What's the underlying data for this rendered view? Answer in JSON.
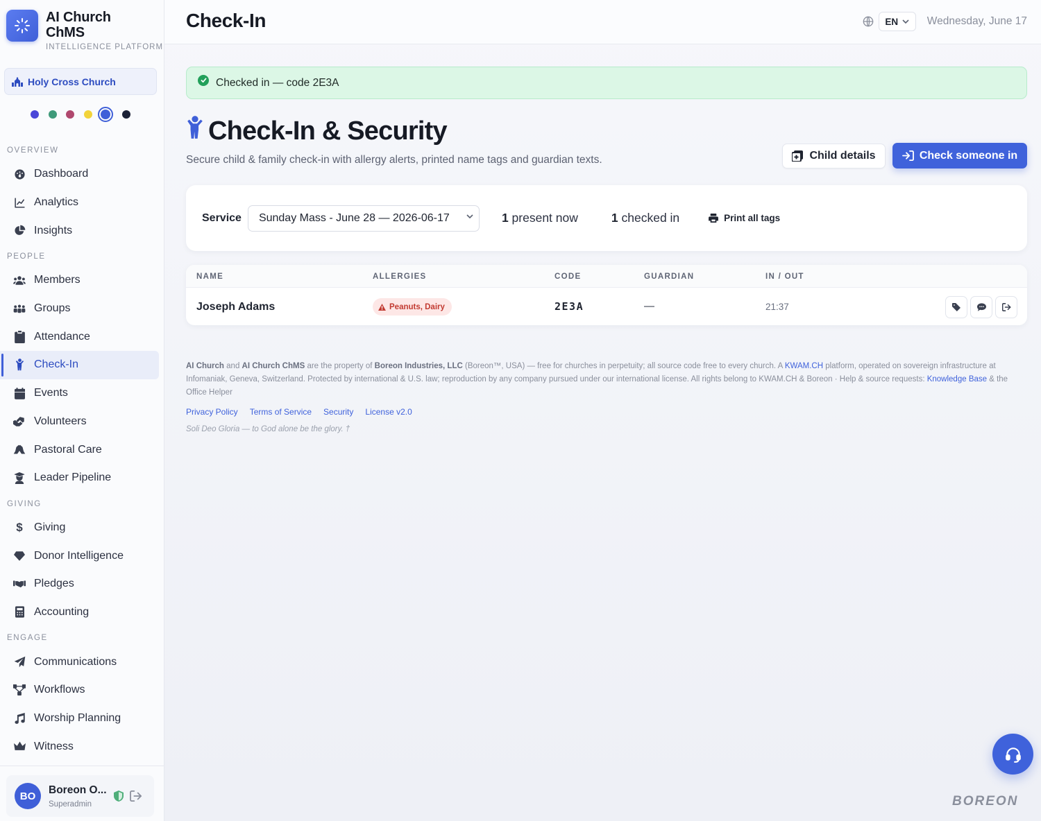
{
  "brand": {
    "title_line1": "AI Church",
    "title_line2": "ChMS",
    "subtitle": "INTELLIGENCE PLATFORM"
  },
  "church": {
    "name": "Holy Cross Church"
  },
  "theme_swatches": [
    "#4a47d8",
    "#3f9a7a",
    "#b0486e",
    "#f2d33a",
    "#3f5fd8",
    "#1b2136"
  ],
  "nav": {
    "sections": [
      {
        "label": "OVERVIEW",
        "items": [
          {
            "label": "Dashboard",
            "icon": "gauge-icon"
          },
          {
            "label": "Analytics",
            "icon": "line-chart-icon"
          },
          {
            "label": "Insights",
            "icon": "pie-chart-icon"
          }
        ]
      },
      {
        "label": "PEOPLE",
        "items": [
          {
            "label": "Members",
            "icon": "users-icon"
          },
          {
            "label": "Groups",
            "icon": "people-group-icon"
          },
          {
            "label": "Attendance",
            "icon": "clipboard-check-icon"
          },
          {
            "label": "Check-In",
            "icon": "child-icon",
            "active": true
          },
          {
            "label": "Events",
            "icon": "calendar-icon"
          },
          {
            "label": "Volunteers",
            "icon": "hands-helping-icon"
          },
          {
            "label": "Pastoral Care",
            "icon": "praying-hands-icon"
          },
          {
            "label": "Leader Pipeline",
            "icon": "graduate-icon"
          }
        ]
      },
      {
        "label": "GIVING",
        "items": [
          {
            "label": "Giving",
            "icon": "dollar-icon"
          },
          {
            "label": "Donor Intelligence",
            "icon": "gem-icon"
          },
          {
            "label": "Pledges",
            "icon": "handshake-icon"
          },
          {
            "label": "Accounting",
            "icon": "calculator-icon"
          }
        ]
      },
      {
        "label": "ENGAGE",
        "items": [
          {
            "label": "Communications",
            "icon": "paper-plane-icon"
          },
          {
            "label": "Workflows",
            "icon": "workflow-icon"
          },
          {
            "label": "Worship Planning",
            "icon": "music-icon"
          },
          {
            "label": "Witness",
            "icon": "crown-icon"
          }
        ]
      }
    ]
  },
  "user": {
    "initials": "BO",
    "name": "Boreon O...",
    "role": "Superadmin"
  },
  "topbar": {
    "title": "Check-In",
    "language": "EN",
    "date": "Wednesday, June 17"
  },
  "alert": {
    "text": "Checked in — code 2E3A"
  },
  "hero": {
    "title": "Check-In & Security",
    "subtitle": "Secure child & family check-in with allergy alerts, printed name tags and guardian texts."
  },
  "actions": {
    "child_details": "Child details",
    "check_in": "Check someone in"
  },
  "filter": {
    "label": "Service",
    "selected_service": "Sunday Mass - June 28 — 2026-06-17",
    "present_count": "1",
    "present_label": "present now",
    "checked_count": "1",
    "checked_label": "checked in",
    "print_label": "Print all tags"
  },
  "table": {
    "columns": [
      "NAME",
      "ALLERGIES",
      "CODE",
      "GUARDIAN",
      "IN / OUT"
    ],
    "rows": [
      {
        "name": "Joseph Adams",
        "allergies": "Peanuts, Dairy",
        "code": "2E3A",
        "guardian": "—",
        "in_out": "21:37"
      }
    ]
  },
  "footer": {
    "p1_brand1": "AI Church",
    "p1_and": " and ",
    "p1_brand2": "AI Church ChMS",
    "p1_prop": " are the property of ",
    "p1_company": "Boreon Industries, LLC",
    "p1_rest": " (Boreon™, USA) — free for churches in perpetuity; all source code free to every church. A ",
    "p1_kwam": "KWAM.CH",
    "p1_rest2": " platform, operated on sovereign infrastructure at Infomaniak, Geneva, Switzerland. Protected by international & U.S. law; reproduction by any company pursued under our international license. All rights belong to KWAM.CH & Boreon · Help & source requests: ",
    "p1_kb": "Knowledge Base",
    "p1_end": " & the Office Helper",
    "links": [
      "Privacy Policy",
      "Terms of Service",
      "Security",
      "License v2.0"
    ],
    "motto": "Soli Deo Gloria — to God alone be the glory. †"
  },
  "watermark": "BOREON"
}
